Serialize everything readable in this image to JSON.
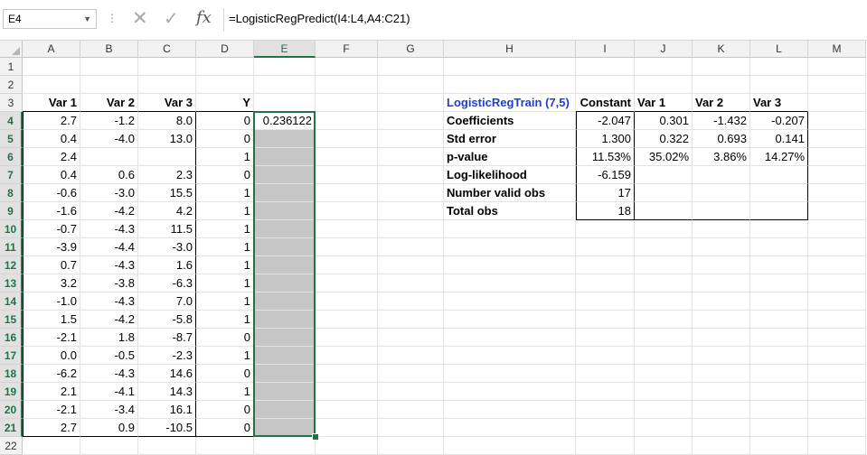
{
  "name_box": "E4",
  "formula_bar": {
    "dots": "⋮",
    "cancel_glyph": "✕",
    "enter_glyph": "✓",
    "fx_label": "fx",
    "formula": "=LogisticRegPredict(I4:L4,A4:C21)"
  },
  "columns": [
    "A",
    "B",
    "C",
    "D",
    "E",
    "F",
    "G",
    "H",
    "I",
    "J",
    "K",
    "L",
    "M"
  ],
  "rows": [
    "1",
    "2",
    "3",
    "4",
    "5",
    "6",
    "7",
    "8",
    "9",
    "10",
    "11",
    "12",
    "13",
    "14",
    "15",
    "16",
    "17",
    "18",
    "19",
    "20",
    "21",
    "22"
  ],
  "selected_col": "E",
  "selected_rows_from": 4,
  "selected_rows_to": 21,
  "headers": {
    "var1": "Var 1",
    "var2": "Var 2",
    "var3": "Var 3",
    "y": "Y"
  },
  "data_rows": [
    [
      "2.7",
      "-1.2",
      "8.0",
      "0"
    ],
    [
      "0.4",
      "-4.0",
      "13.0",
      "0"
    ],
    [
      "2.4",
      "",
      "",
      "1"
    ],
    [
      "0.4",
      "0.6",
      "2.3",
      "0"
    ],
    [
      "-0.6",
      "-3.0",
      "15.5",
      "1"
    ],
    [
      "-1.6",
      "-4.2",
      "4.2",
      "1"
    ],
    [
      "-0.7",
      "-4.3",
      "11.5",
      "1"
    ],
    [
      "-3.9",
      "-4.4",
      "-3.0",
      "1"
    ],
    [
      "0.7",
      "-4.3",
      "1.6",
      "1"
    ],
    [
      "3.2",
      "-3.8",
      "-6.3",
      "1"
    ],
    [
      "-1.0",
      "-4.3",
      "7.0",
      "1"
    ],
    [
      "1.5",
      "-4.2",
      "-5.8",
      "1"
    ],
    [
      "-2.1",
      "1.8",
      "-8.7",
      "0"
    ],
    [
      "0.0",
      "-0.5",
      "-2.3",
      "1"
    ],
    [
      "-6.2",
      "-4.3",
      "14.6",
      "0"
    ],
    [
      "2.1",
      "-4.1",
      "14.3",
      "1"
    ],
    [
      "-2.1",
      "-3.4",
      "16.1",
      "0"
    ],
    [
      "2.7",
      "0.9",
      "-10.5",
      "0"
    ]
  ],
  "e4_value": "0.236122",
  "model": {
    "title": "LogisticRegTrain (7,5)",
    "headers": [
      "Constant",
      "Var 1",
      "Var 2",
      "Var 3"
    ],
    "rows": [
      {
        "label": "Coefficients",
        "values": [
          "-2.047",
          "0.301",
          "-1.432",
          "-0.207"
        ]
      },
      {
        "label": "Std error",
        "values": [
          "1.300",
          "0.322",
          "0.693",
          "0.141"
        ]
      },
      {
        "label": "p-value",
        "values": [
          "11.53%",
          "35.02%",
          "3.86%",
          "14.27%"
        ]
      },
      {
        "label": "Log-likelihood",
        "values": [
          "-6.159",
          "",
          "",
          ""
        ]
      },
      {
        "label": "Number valid obs",
        "values": [
          "17",
          "",
          "",
          ""
        ]
      },
      {
        "label": "Total obs",
        "values": [
          "18",
          "",
          "",
          ""
        ]
      }
    ]
  }
}
